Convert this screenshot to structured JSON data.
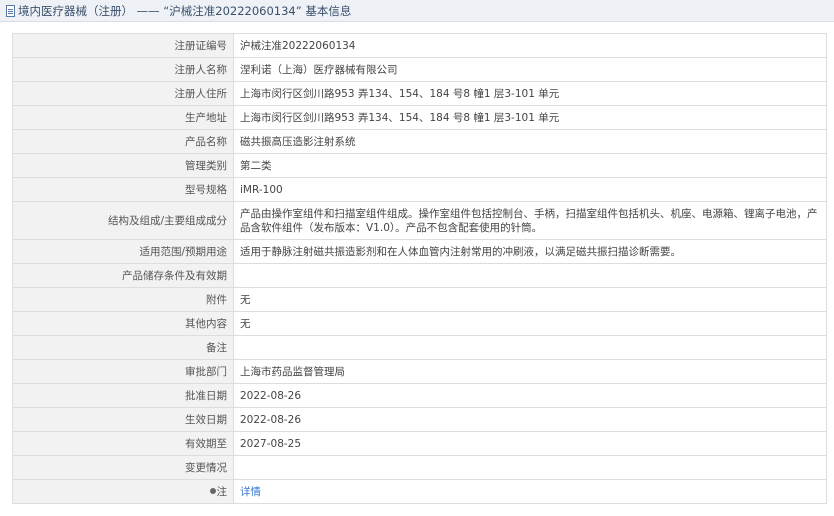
{
  "header": {
    "title": "境内医疗器械（注册） —— “沪械注准20222060134” 基本信息",
    "icon": "document-icon"
  },
  "rows": [
    {
      "label": "注册证编号",
      "value": "沪械注准20222060134"
    },
    {
      "label": "注册人名称",
      "value": "涅利诺（上海）医疗器械有限公司"
    },
    {
      "label": "注册人住所",
      "value": "上海市闵行区剑川路953 弄134、154、184 号8 幢1 层3-101 单元"
    },
    {
      "label": "生产地址",
      "value": "上海市闵行区剑川路953 弄134、154、184 号8 幢1 层3-101 单元"
    },
    {
      "label": "产品名称",
      "value": "磁共振高压造影注射系统"
    },
    {
      "label": "管理类别",
      "value": "第二类"
    },
    {
      "label": "型号规格",
      "value": "iMR-100"
    },
    {
      "label": "结构及组成/主要组成成分",
      "value": "产品由操作室组件和扫描室组件组成。操作室组件包括控制台、手柄，扫描室组件包括机头、机座、电源箱、锂离子电池，产品含软件组件（发布版本：V1.0）。产品不包含配套使用的针筒。"
    },
    {
      "label": "适用范围/预期用途",
      "value": "适用于静脉注射磁共振造影剂和在人体血管内注射常用的冲刷液，以满足磁共振扫描诊断需要。"
    },
    {
      "label": "产品储存条件及有效期",
      "value": ""
    },
    {
      "label": "附件",
      "value": "无"
    },
    {
      "label": "其他内容",
      "value": "无"
    },
    {
      "label": "备注",
      "value": ""
    },
    {
      "label": "审批部门",
      "value": "上海市药品监督管理局"
    },
    {
      "label": "批准日期",
      "value": "2022-08-26"
    },
    {
      "label": "生效日期",
      "value": "2022-08-26"
    },
    {
      "label": "有效期至",
      "value": "2027-08-25"
    },
    {
      "label": "变更情况",
      "value": ""
    }
  ],
  "note": {
    "label": "注",
    "link_text": "详情",
    "icon": "bullet-icon"
  }
}
